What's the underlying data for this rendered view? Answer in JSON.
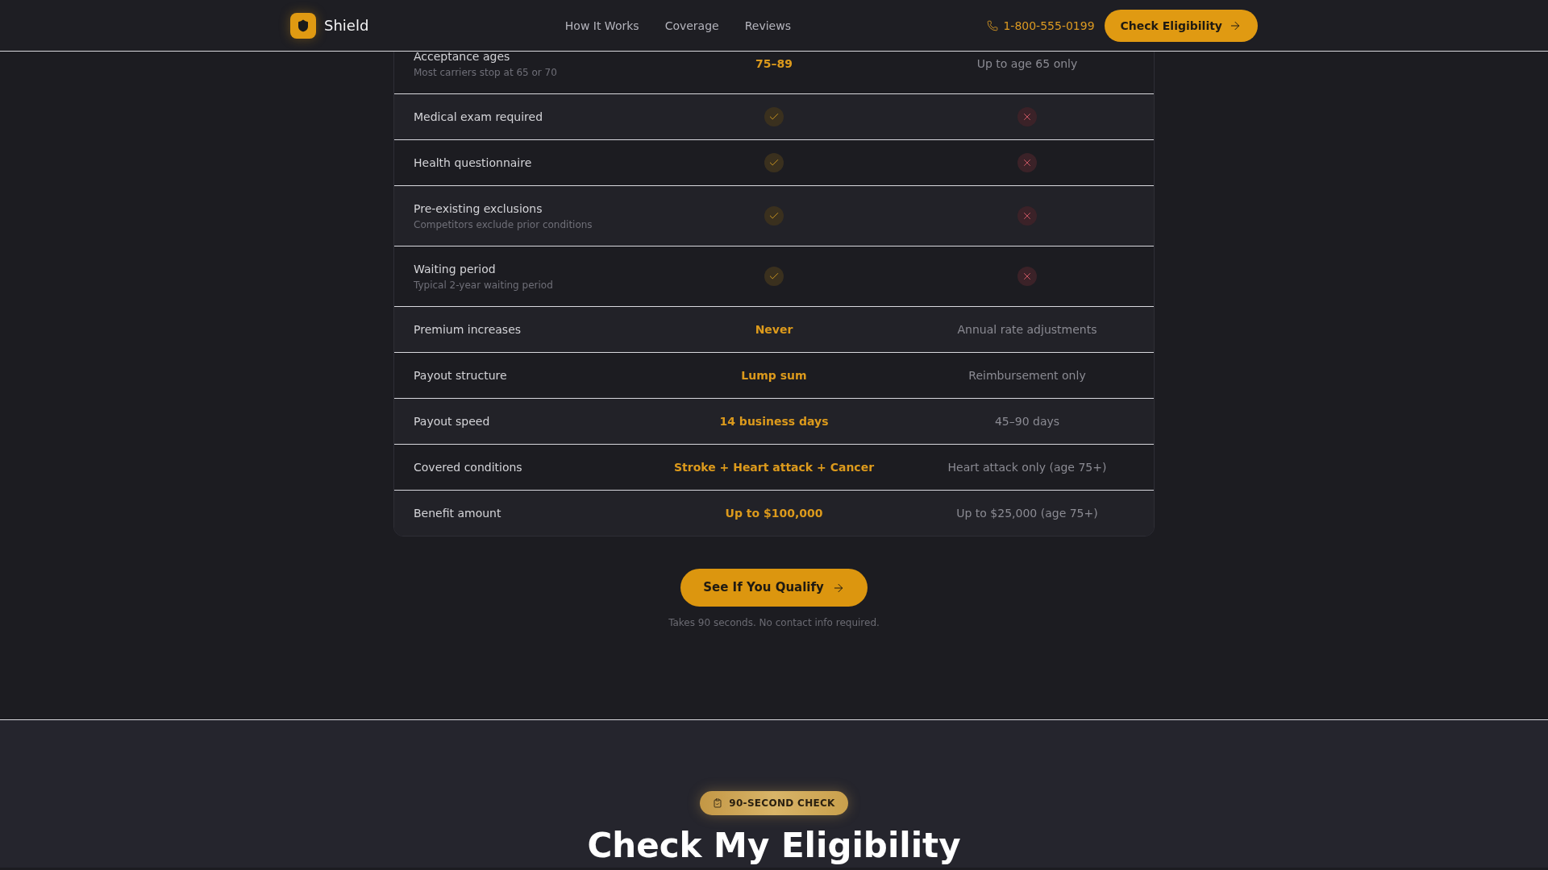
{
  "header": {
    "brand": "Shield",
    "nav": [
      "How It Works",
      "Coverage",
      "Reviews"
    ],
    "phone": "1-800-555-0199",
    "button": "Check Eligibility"
  },
  "comparison": {
    "rows": [
      {
        "label": "Acceptance ages",
        "note": "Most carriers stop at 65 or 70",
        "ours": {
          "kind": "text",
          "value": "75–89"
        },
        "theirs": {
          "kind": "text",
          "value": "Up to age 65 only"
        }
      },
      {
        "label": "Medical exam required",
        "ours": {
          "kind": "check"
        },
        "theirs": {
          "kind": "cross"
        }
      },
      {
        "label": "Health questionnaire",
        "ours": {
          "kind": "check"
        },
        "theirs": {
          "kind": "cross"
        }
      },
      {
        "label": "Pre-existing exclusions",
        "note": "Competitors exclude prior conditions",
        "ours": {
          "kind": "check"
        },
        "theirs": {
          "kind": "cross"
        }
      },
      {
        "label": "Waiting period",
        "note": "Typical 2-year waiting period",
        "ours": {
          "kind": "check"
        },
        "theirs": {
          "kind": "cross"
        }
      },
      {
        "label": "Premium increases",
        "ours": {
          "kind": "text",
          "value": "Never"
        },
        "theirs": {
          "kind": "text",
          "value": "Annual rate adjustments"
        }
      },
      {
        "label": "Payout structure",
        "ours": {
          "kind": "text",
          "value": "Lump sum"
        },
        "theirs": {
          "kind": "text",
          "value": "Reimbursement only"
        }
      },
      {
        "label": "Payout speed",
        "ours": {
          "kind": "text",
          "value": "14 business days"
        },
        "theirs": {
          "kind": "text",
          "value": "45–90 days"
        }
      },
      {
        "label": "Covered conditions",
        "ours": {
          "kind": "text",
          "value": "Stroke + Heart attack + Cancer"
        },
        "theirs": {
          "kind": "text",
          "value": "Heart attack only (age 75+)"
        }
      },
      {
        "label": "Benefit amount",
        "ours": {
          "kind": "text",
          "value": "Up to $100,000"
        },
        "theirs": {
          "kind": "text",
          "value": "Up to $25,000 (age 75+)"
        }
      }
    ]
  },
  "cta": {
    "button": "See If You Qualify",
    "note": "Takes 90 seconds. No contact info required."
  },
  "eligibility": {
    "badge": "90-SECOND CHECK",
    "heading": "Check My Eligibility"
  }
}
